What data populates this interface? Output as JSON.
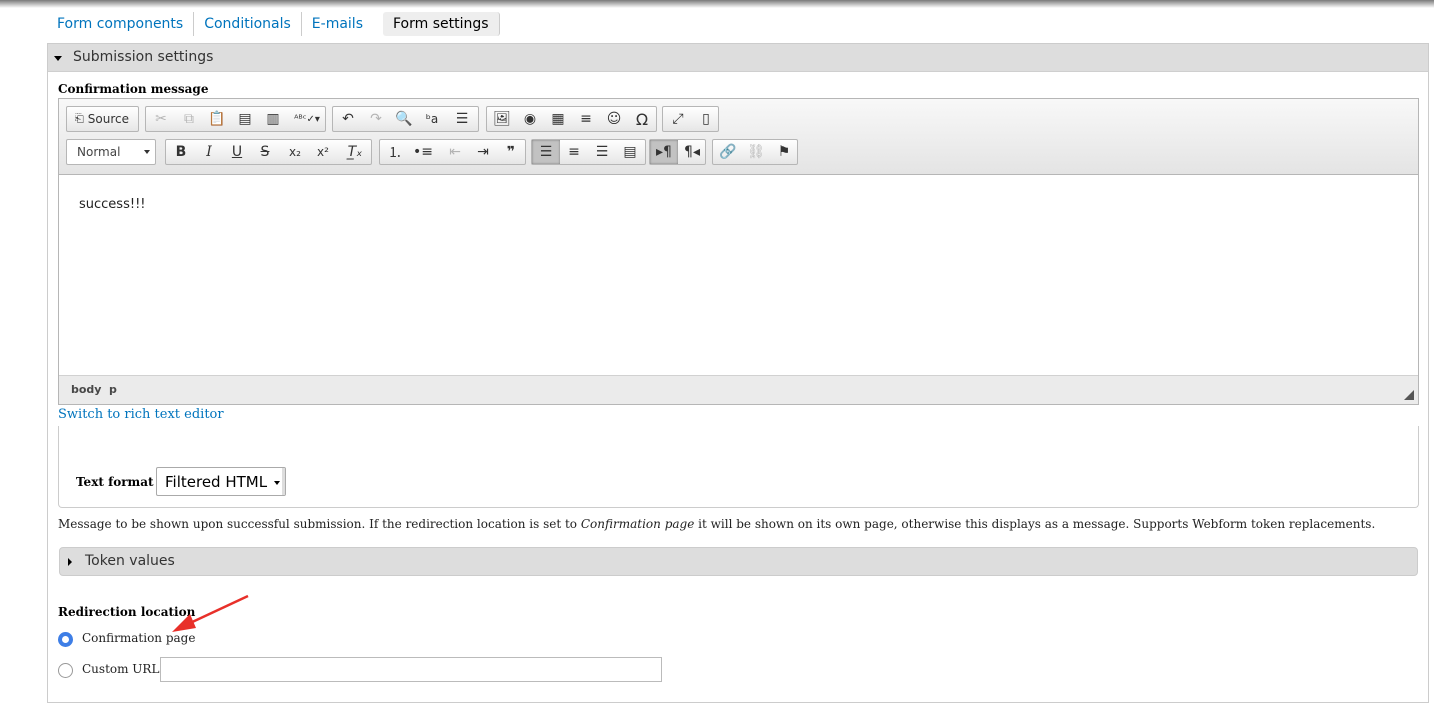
{
  "tabs": [
    {
      "label": "Form components"
    },
    {
      "label": "Conditionals"
    },
    {
      "label": "E-mails"
    },
    {
      "label": "Form settings"
    }
  ],
  "submission": {
    "legend": "Submission settings",
    "confirmation_label": "Confirmation message",
    "editor": {
      "source_label": "Source",
      "format_combo": "Normal",
      "content": "success!!!",
      "path": [
        "body",
        "p"
      ]
    },
    "switch_link": "Switch to rich text editor",
    "text_format_label": "Text format",
    "text_format_value": "Filtered HTML",
    "description_pre": "Message to be shown upon successful submission. If the redirection location is set to ",
    "description_em": "Confirmation page",
    "description_post": " it will be shown on its own page, otherwise this displays as a message. Supports Webform token replacements.",
    "token_values_legend": "Token values",
    "redirection_label": "Redirection location",
    "redirect_options": [
      {
        "label": "Confirmation page",
        "selected": true
      },
      {
        "label": "Custom URL:",
        "selected": false
      }
    ],
    "custom_url_value": ""
  },
  "colors": {
    "link": "#0074bd",
    "radio_selected": "#3e7ee6",
    "annotation_arrow": "#e8302a"
  }
}
